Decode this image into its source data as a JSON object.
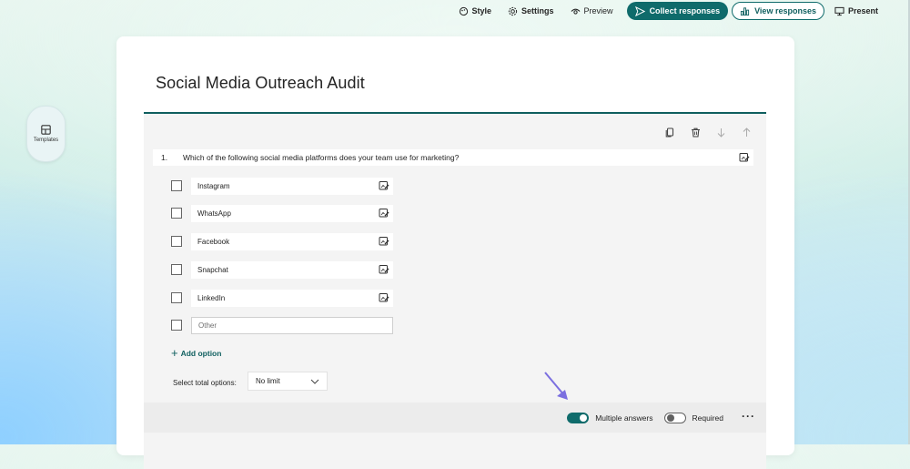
{
  "topbar": {
    "style_label": "Style",
    "settings_label": "Settings",
    "preview_label": "Preview",
    "collect_label": "Collect responses",
    "view_label": "View responses",
    "present_label": "Present"
  },
  "sidebar": {
    "templates_label": "Templates"
  },
  "form": {
    "title": "Social Media Outreach Audit"
  },
  "question": {
    "number": "1.",
    "text": "Which of the following social media platforms does your team use for marketing?",
    "options": [
      "Instagram",
      "WhatsApp",
      "Facebook",
      "Snapchat",
      "LinkedIn"
    ],
    "other_placeholder": "Other",
    "add_option_label": "Add option",
    "select_total_label": "Select total options:",
    "select_total_value": "No limit",
    "multiple_answers_label": "Multiple answers",
    "multiple_answers_on": true,
    "required_label": "Required",
    "required_on": false
  },
  "colors": {
    "accent": "#0f6b6b",
    "arrow": "#7b6fe0"
  },
  "icons": [
    "style-icon",
    "settings-icon",
    "preview-icon",
    "send-icon",
    "chart-icon",
    "present-icon",
    "templates-icon",
    "copy-icon",
    "delete-icon",
    "move-down-icon",
    "move-up-icon",
    "image-edit-icon",
    "chevron-down-icon",
    "more-icon"
  ]
}
